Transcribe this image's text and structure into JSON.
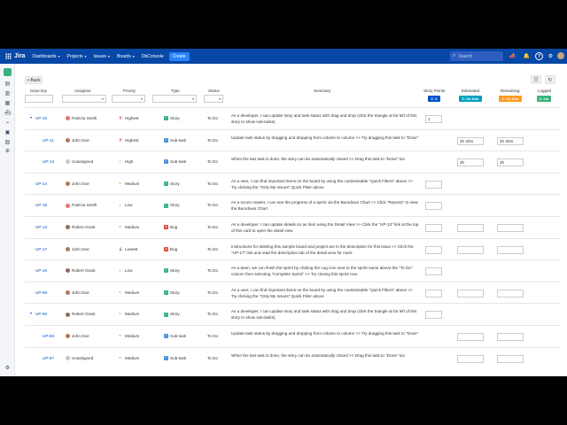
{
  "topnav": {
    "app": "Jira",
    "menus": [
      {
        "label": "Dashboards",
        "caret": "▾"
      },
      {
        "label": "Projects",
        "caret": "▾"
      },
      {
        "label": "Issues",
        "caret": "▾"
      },
      {
        "label": "Boards",
        "caret": "▾"
      },
      {
        "label": "DbConsole",
        "caret": ""
      }
    ],
    "create_label": "Create",
    "search_placeholder": "Search",
    "icons": [
      "megaphone-icon",
      "bell-icon",
      "help-icon",
      "settings-icon",
      "user-avatar"
    ]
  },
  "toolbar": {
    "back_label": "Back",
    "back_arrow": "⇐"
  },
  "columns": {
    "issue_key": "Issue key",
    "assignee": "Assignee",
    "priority": "Priority",
    "type": "Type",
    "status": "Status",
    "summary": "Summary",
    "story_points": "Story Points",
    "estimated": "Estimated",
    "remaining": "Remaining",
    "logged": "Logged"
  },
  "totals": {
    "story_points": "Σ: 0",
    "estimated": "Σ: 5h 30m",
    "remaining": "Σ: 5h 30m",
    "logged": "Σ: 0m"
  },
  "colors": {
    "nav": "#0747a6",
    "story_points_badge": "#0052cc",
    "estimated_badge": "#00a3bf",
    "remaining_badge": "#ff991f",
    "logged_badge": "#36b37e"
  },
  "rows": [
    {
      "caret": "▾",
      "key": "UP-10",
      "assignee": "Patricia Smith",
      "avatar_color": "#e57373",
      "priority": "Highest",
      "pri_icon": "⇈",
      "pri_color": "#d04437",
      "type": "Story",
      "type_color": "#36b37e",
      "status": "To Do",
      "summary": "As a developer, I can update story and task status with drag and drop (click the triangle at far left of this story to show sub-tasks)",
      "sp": "1",
      "est": "",
      "rem": "",
      "sp_box": true,
      "est_box": false,
      "rem_box": false,
      "indent": 0
    },
    {
      "caret": "",
      "key": "UP-11",
      "assignee": "John Doe",
      "avatar_color": "#b0785c",
      "priority": "Highest",
      "pri_icon": "⇈",
      "pri_color": "#d04437",
      "type": "Sub-task",
      "type_color": "#4a90d9",
      "status": "To Do",
      "summary": "Update task status by dragging and dropping from column to column >> Try dragging this task to \"Done\"",
      "sp": "",
      "est": "2h 30m",
      "rem": "2h 30m",
      "sp_box": false,
      "est_box": true,
      "rem_box": true,
      "indent": 1
    },
    {
      "caret": "",
      "key": "UP-12",
      "assignee": "Unassigned",
      "avatar_color": "#c1c7d0",
      "priority": "High",
      "pri_icon": "↑",
      "pri_color": "#e5493a",
      "type": "Sub-task",
      "type_color": "#4a90d9",
      "status": "To Do",
      "summary": "When the last task is done, the story can be automatically closed >> Drag this task to \"Done\" too",
      "sp": "",
      "est": "3h",
      "rem": "3h",
      "sp_box": false,
      "est_box": true,
      "rem_box": true,
      "indent": 1
    },
    {
      "caret": "",
      "key": "UP-14",
      "assignee": "John Doe",
      "avatar_color": "#b0785c",
      "priority": "Medium",
      "pri_icon": "=",
      "pri_color": "#e8a33d",
      "type": "Story",
      "type_color": "#36b37e",
      "status": "To Do",
      "summary": "As a user, I can find important items on the board by using the customisable \"Quick Filters\" above >> Try clicking the \"Only My Issues\" Quick Filter above",
      "sp": "",
      "est": "",
      "rem": "",
      "sp_box": true,
      "est_box": false,
      "rem_box": false,
      "indent": 0
    },
    {
      "caret": "",
      "key": "UP-15",
      "assignee": "Patricia Smith",
      "avatar_color": "#e57373",
      "priority": "Low",
      "pri_icon": "↓",
      "pri_color": "#2a8735",
      "type": "Story",
      "type_color": "#36b37e",
      "status": "To Do",
      "summary": "As a scrum master, I can see the progress of a sprint via the Burndown Chart >> Click \"Reports\" to view the Burndown Chart",
      "sp": "",
      "est": "",
      "rem": "",
      "sp_box": true,
      "est_box": false,
      "rem_box": false,
      "indent": 0
    },
    {
      "caret": "",
      "key": "UP-13",
      "assignee": "Robert Grant",
      "avatar_color": "#8d6e63",
      "priority": "Medium",
      "pri_icon": "=",
      "pri_color": "#e8a33d",
      "type": "Bug",
      "type_color": "#e5493a",
      "status": "To Do",
      "summary": "As a developer, I can update details on an item using the Detail View >> Click the \"UP-13\" link at the top of this card to open the detail view",
      "sp": "",
      "est": "",
      "rem": "",
      "sp_box": true,
      "est_box": true,
      "rem_box": true,
      "indent": 0
    },
    {
      "caret": "",
      "key": "UP-17",
      "assignee": "John Doe",
      "avatar_color": "#b0785c",
      "priority": "Lowest",
      "pri_icon": "⇊",
      "pri_color": "#2a8735",
      "type": "Bug",
      "type_color": "#e5493a",
      "status": "To Do",
      "summary": "Instructions for deleting this sample board and project are in the description for this issue >> Click the \"UP-17\" link and read the description tab of the detail view for more",
      "sp": "",
      "est": "",
      "rem": "",
      "sp_box": true,
      "est_box": true,
      "rem_box": true,
      "indent": 0
    },
    {
      "caret": "",
      "key": "UP-16",
      "assignee": "Robert Grant",
      "avatar_color": "#8d6e63",
      "priority": "Low",
      "pri_icon": "↓",
      "pri_color": "#2a8735",
      "type": "Story",
      "type_color": "#36b37e",
      "status": "To Do",
      "summary": "As a team, we can finish the sprint by clicking the cog icon next to the sprint name above the \"To Do\" column then selecting \"Complete Sprint\" >> Try closing this sprint now",
      "sp": "",
      "est": "",
      "rem": "",
      "sp_box": true,
      "est_box": false,
      "rem_box": false,
      "indent": 0
    },
    {
      "caret": "",
      "key": "UP-59",
      "assignee": "John Doe",
      "avatar_color": "#b0785c",
      "priority": "Medium",
      "pri_icon": "=",
      "pri_color": "#e8a33d",
      "type": "Story",
      "type_color": "#36b37e",
      "status": "To Do",
      "summary": "As a user, I can find important items on the board by using the customisable \"Quick Filters\" above >> Try clicking the \"Only My Issues\" Quick Filter above",
      "sp": "",
      "est": "",
      "rem": "",
      "sp_box": true,
      "est_box": true,
      "rem_box": true,
      "indent": 0
    },
    {
      "caret": "▾",
      "key": "UP-55",
      "assignee": "Robert Grant",
      "avatar_color": "#8d6e63",
      "priority": "Medium",
      "pri_icon": "=",
      "pri_color": "#e8a33d",
      "type": "Story",
      "type_color": "#36b37e",
      "status": "To Do",
      "summary": "As a developer, I can update story and task status with drag and drop (click the triangle at far left of this story to show sub-tasks)",
      "sp": "",
      "est": "",
      "rem": "",
      "sp_box": true,
      "est_box": false,
      "rem_box": false,
      "indent": 0
    },
    {
      "caret": "",
      "key": "UP-56",
      "assignee": "John Doe",
      "avatar_color": "#b0785c",
      "priority": "Medium",
      "pri_icon": "=",
      "pri_color": "#e8a33d",
      "type": "Sub-task",
      "type_color": "#4a90d9",
      "status": "To Do",
      "summary": "Update task status by dragging and dropping from column to column >> Try dragging this task to \"Done\"",
      "sp": "",
      "est": "",
      "rem": "",
      "sp_box": false,
      "est_box": true,
      "rem_box": true,
      "indent": 1
    },
    {
      "caret": "",
      "key": "UP-57",
      "assignee": "Unassigned",
      "avatar_color": "#c1c7d0",
      "priority": "Medium",
      "pri_icon": "=",
      "pri_color": "#e8a33d",
      "type": "Sub-task",
      "type_color": "#4a90d9",
      "status": "To Do",
      "summary": "When the last task is done, the story can be automatically closed >> Drag this task to \"Done\" too",
      "sp": "",
      "est": "",
      "rem": "",
      "sp_box": false,
      "est_box": true,
      "rem_box": true,
      "indent": 1
    }
  ]
}
